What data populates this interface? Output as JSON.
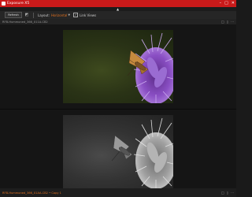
{
  "window": {
    "title": "Exposure X5",
    "controls": {
      "minimize": "–",
      "maximize": "□",
      "close": "✕"
    }
  },
  "collapse_arrow": "▲",
  "toolbar": {
    "button_label": "Refresh",
    "layout_label": "Layout:",
    "layout_value": "Horizontal",
    "link_checked": true,
    "link_label": "Link Views"
  },
  "pane_top": {
    "filename": "RFB-Hummoned_366_X11A-CB2",
    "tools": [
      "□",
      "▯",
      "⋯"
    ]
  },
  "pane_bottom": {
    "filename": "RFB-Hummoned_366_X1AA-CB2 • Copy 1",
    "tools": [
      "□",
      "▯",
      "⋯"
    ]
  },
  "colors": {
    "title_bar": "#c91a1a",
    "accent": "#e07020",
    "flower": "#8a4fc4"
  },
  "icons": [
    "app-icon",
    "collapse-arrow-icon",
    "compare-icon",
    "split-view-icon",
    "dropdown-chevron-icon",
    "checkmark-icon"
  ]
}
